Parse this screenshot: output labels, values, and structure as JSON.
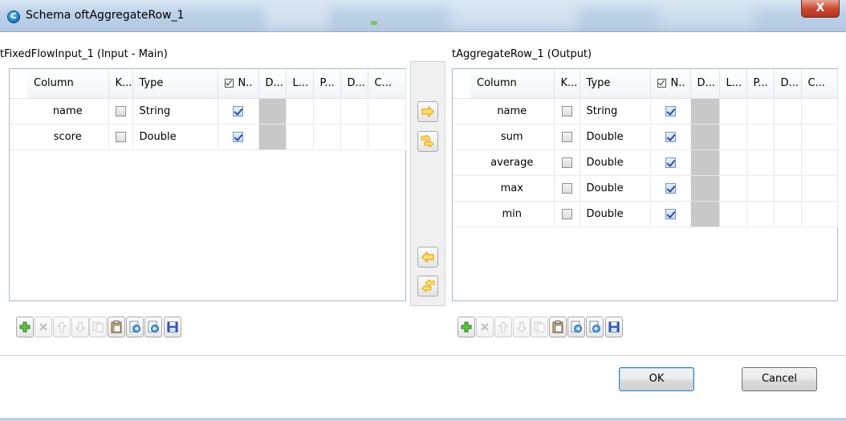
{
  "window": {
    "title": "Schema oftAggregateRow_1",
    "app_icon_letter": "C",
    "close_glyph": "X"
  },
  "input_panel": {
    "title": "tFixedFlowInput_1 (Input - Main)",
    "columns": [
      "Column",
      "K...",
      "Type",
      "N..",
      "D...",
      "L...",
      "P...",
      "D...",
      "C..."
    ],
    "rows": [
      {
        "name": "name",
        "key": false,
        "type": "String",
        "nullable": true
      },
      {
        "name": "score",
        "key": false,
        "type": "Double",
        "nullable": true
      }
    ]
  },
  "output_panel": {
    "title": "tAggregateRow_1 (Output)",
    "columns": [
      "Column",
      "K...",
      "Type",
      "N..",
      "D...",
      "L...",
      "P...",
      "D...",
      "C..."
    ],
    "rows": [
      {
        "name": "name",
        "key": false,
        "type": "String",
        "nullable": true
      },
      {
        "name": "sum",
        "key": false,
        "type": "Double",
        "nullable": true
      },
      {
        "name": "average",
        "key": false,
        "type": "Double",
        "nullable": true
      },
      {
        "name": "max",
        "key": false,
        "type": "Double",
        "nullable": true
      },
      {
        "name": "min",
        "key": false,
        "type": "Double",
        "nullable": true
      }
    ]
  },
  "middle_buttons": [
    {
      "name": "copy-selected-to-output-button",
      "icon": "arrow-right-icon"
    },
    {
      "name": "copy-all-to-output-button",
      "icon": "double-arrow-right-icon"
    },
    {
      "name": "copy-selected-to-input-button",
      "icon": "arrow-left-icon"
    },
    {
      "name": "copy-all-to-input-button",
      "icon": "double-arrow-left-icon"
    }
  ],
  "toolbar": [
    {
      "name": "add-button",
      "icon": "plus-icon",
      "enabled": true
    },
    {
      "name": "remove-button",
      "icon": "cross-icon",
      "enabled": false
    },
    {
      "name": "move-up-button",
      "icon": "arrow-up-icon",
      "enabled": false
    },
    {
      "name": "move-down-button",
      "icon": "arrow-down-icon",
      "enabled": false
    },
    {
      "name": "copy-button",
      "icon": "copy-icon",
      "enabled": false
    },
    {
      "name": "paste-button",
      "icon": "paste-icon",
      "enabled": true
    },
    {
      "name": "import-button",
      "icon": "import-icon",
      "enabled": true
    },
    {
      "name": "export-button",
      "icon": "export-icon",
      "enabled": true
    },
    {
      "name": "save-button",
      "icon": "floppy-icon",
      "enabled": true
    }
  ],
  "buttons": {
    "ok": "OK",
    "cancel": "Cancel"
  },
  "colors": {
    "accent_blue": "#2c4f9a",
    "add_green": "#3e9a2f",
    "arrow_orange": "#e8a200",
    "grey_cell": "#c8c8c8"
  }
}
